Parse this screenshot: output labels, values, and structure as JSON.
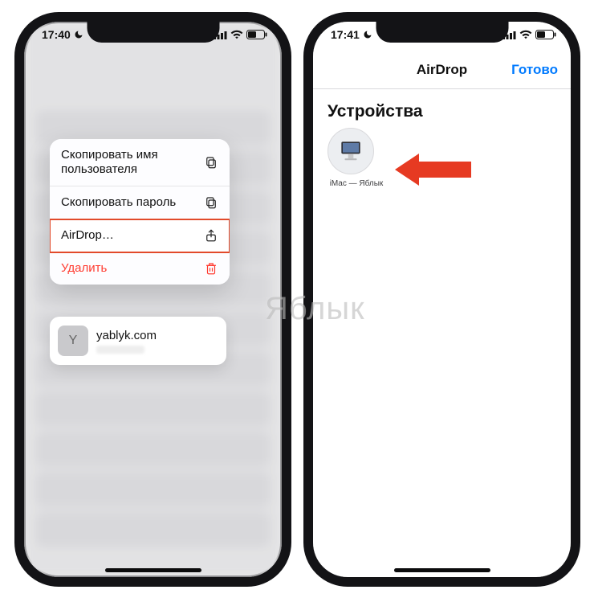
{
  "watermark": "Яблык",
  "left": {
    "status": {
      "time": "17:40"
    },
    "menu": {
      "copy_username": "Скопировать имя пользователя",
      "copy_password": "Скопировать пароль",
      "airdrop": "AirDrop…",
      "delete": "Удалить"
    },
    "preview": {
      "badge": "Y",
      "title": "yablyk.com"
    }
  },
  "right": {
    "status": {
      "time": "17:41"
    },
    "nav": {
      "title": "AirDrop",
      "done": "Готово"
    },
    "section": "Устройства",
    "device": {
      "label": "iMac — Яблык"
    }
  }
}
